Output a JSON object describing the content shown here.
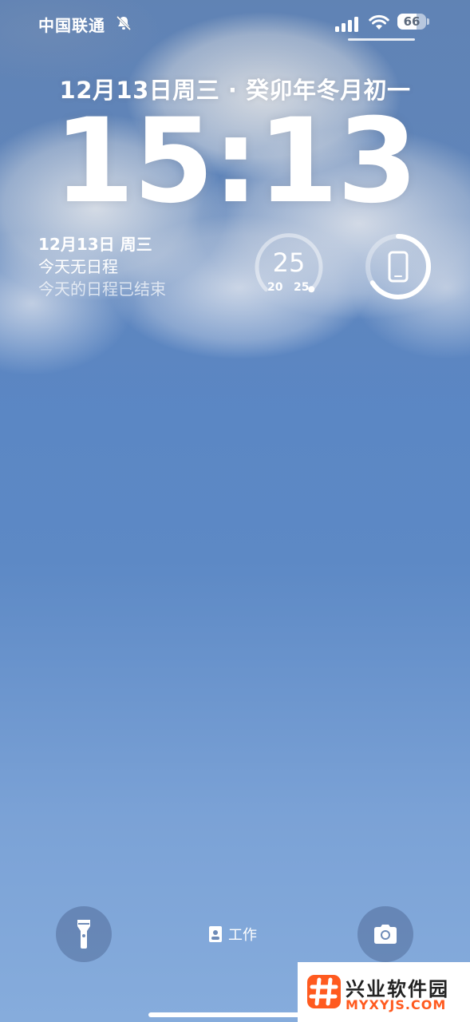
{
  "status_bar": {
    "carrier": "中国联通",
    "battery_percent": 66,
    "battery_text": "66",
    "icons": [
      "bell-slash-icon",
      "signal-icon",
      "wifi-icon",
      "battery-icon"
    ]
  },
  "lockscreen": {
    "date_line": "12月13日周三 · 癸卯年冬月初一",
    "time": "15:13"
  },
  "calendar_widget": {
    "date": "12月13日 周三",
    "line2": "今天无日程",
    "line3": "今天的日程已结束"
  },
  "weather_widget": {
    "current": "25",
    "low": "20",
    "high": "25",
    "position_fraction": 1.0
  },
  "battery_widget": {
    "icon": "iphone-icon",
    "level_fraction": 0.66
  },
  "bottom": {
    "focus_label": "工作",
    "buttons": [
      "flashlight-icon",
      "camera-icon"
    ]
  },
  "watermark": {
    "name": "兴业软件园",
    "url": "MYXYJS.COM",
    "accent": "#ff5a1f"
  },
  "colors": {
    "sky_top": "#5b87c6",
    "sky_bottom": "#86acdc"
  }
}
